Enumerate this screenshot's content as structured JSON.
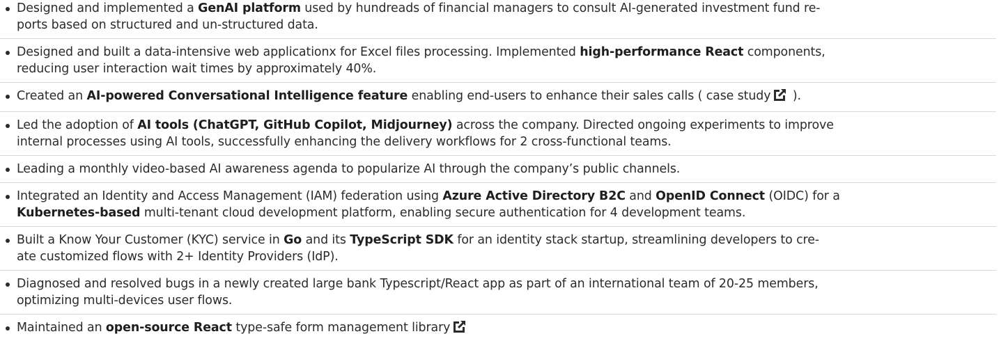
{
  "icons": {
    "external_link": "external-link-icon"
  },
  "items": [
    {
      "parts": [
        {
          "t": "Designed and implemented a "
        },
        {
          "t": "GenAI platform",
          "b": true
        },
        {
          "t": " used by hundreads of financial managers to consult AI-generated investment fund re-\nports based on structured and un-structured data."
        }
      ]
    },
    {
      "parts": [
        {
          "t": "Designed and built a data-intensive web applicationx for Excel files processing. Implemented "
        },
        {
          "t": "high-performance React",
          "b": true
        },
        {
          "t": " components,\nreducing user interaction wait times by approximately 40%."
        }
      ]
    },
    {
      "parts": [
        {
          "t": "Created an "
        },
        {
          "t": "AI-powered Conversational Intelligence feature",
          "b": true
        },
        {
          "t": " enabling end-users to enhance their sales calls ( case study"
        },
        {
          "icon": "external-link-icon"
        },
        {
          "t": " )."
        }
      ]
    },
    {
      "parts": [
        {
          "t": "Led the adoption of "
        },
        {
          "t": "AI tools (ChatGPT, GitHub Copilot, Midjourney)",
          "b": true
        },
        {
          "t": " across the company. Directed ongoing experiments to improve\ninternal processes using AI tools, successfully enhancing the delivery workflows for 2 cross-functional teams."
        }
      ]
    },
    {
      "parts": [
        {
          "t": "Leading a monthly video-based AI awareness agenda to popularize AI through the company’s public channels."
        }
      ]
    },
    {
      "parts": [
        {
          "t": "Integrated an Identity and Access Management (IAM) federation using "
        },
        {
          "t": "Azure Active Directory B2C",
          "b": true
        },
        {
          "t": " and "
        },
        {
          "t": "OpenID Connect",
          "b": true
        },
        {
          "t": " (OIDC) for a\n"
        },
        {
          "t": "Kubernetes-based",
          "b": true
        },
        {
          "t": " multi-tenant cloud development platform, enabling secure authentication for 4 development teams."
        }
      ]
    },
    {
      "parts": [
        {
          "t": "Built a Know Your Customer (KYC) service in "
        },
        {
          "t": "Go",
          "b": true
        },
        {
          "t": " and its "
        },
        {
          "t": "TypeScript SDK",
          "b": true
        },
        {
          "t": "  for an identity stack startup, streamlining developers to cre-\nate customized flows with 2+ Identity Providers (IdP)."
        }
      ]
    },
    {
      "parts": [
        {
          "t": "Diagnosed and resolved bugs in a newly created large bank Typescript/React app as part of an international team of 20-25 members,\noptimizing multi-devices user flows."
        }
      ]
    },
    {
      "parts": [
        {
          "t": "Maintained an "
        },
        {
          "t": "open-source React",
          "b": true
        },
        {
          "t": " type-safe form management library"
        },
        {
          "icon": "external-link-icon"
        }
      ]
    }
  ]
}
